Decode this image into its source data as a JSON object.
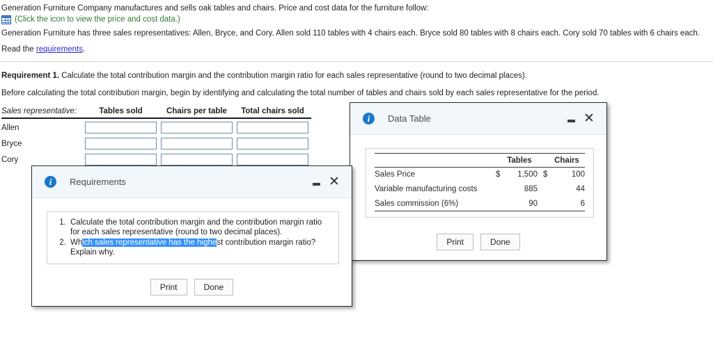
{
  "problem": {
    "intro": "Generation Furniture Company manufactures and sells oak tables and chairs. Price and cost data for the furniture follow:",
    "icon_name": "table-grid-icon",
    "icon_link": "(Click the icon to view the price and cost data.)",
    "reps_line": "Generation Furniture has three sales representatives: Allen, Bryce, and Cory. Allen sold 110 tables with 4 chairs each. Bryce sold 80 tables with 8 chairs each. Cory sold 70 tables with 6 chairs each.",
    "read_prefix": "Read the ",
    "read_link": "requirements",
    "read_suffix": "."
  },
  "requirement1": {
    "label": "Requirement 1.",
    "text": " Calculate the total contribution margin and the contribution margin ratio for each sales representative (round to two decimal places).",
    "before_text": "Before calculating the total contribution margin, begin by identifying and calculating the total number of tables and chairs sold by each sales representative for the period."
  },
  "answer_table": {
    "row_header": "Sales representative:",
    "columns": [
      "Tables sold",
      "Chairs per table",
      "Total chairs sold"
    ],
    "rows": [
      {
        "name": "Allen",
        "tables_sold": "",
        "chairs_per_table": "",
        "total_chairs_sold": ""
      },
      {
        "name": "Bryce",
        "tables_sold": "",
        "chairs_per_table": "",
        "total_chairs_sold": ""
      },
      {
        "name": "Cory",
        "tables_sold": "",
        "chairs_per_table": "",
        "total_chairs_sold": ""
      }
    ]
  },
  "requirements_dialog": {
    "title": "Requirements",
    "info_icon": "info-icon",
    "minimize_icon": "minimize-icon",
    "close_icon": "close-icon",
    "items": [
      {
        "number": "1.",
        "text": "Calculate the total contribution margin and the contribution margin ratio for each sales representative (round to two decimal places)."
      },
      {
        "number": "2.",
        "pre_selection": "Wh",
        "selection": "ich sales representative has the highe",
        "post_selection": "st contribution margin ratio? Explain why."
      }
    ],
    "print_label": "Print",
    "done_label": "Done",
    "selection_color": "#3390ff"
  },
  "data_table_dialog": {
    "title": "Data Table",
    "info_icon": "info-icon",
    "minimize_icon": "minimize-icon",
    "close_icon": "close-icon",
    "columns": [
      "Tables",
      "Chairs"
    ],
    "rows": [
      {
        "label": "Sales Price",
        "tables_currency": "$",
        "tables_value": "1,500",
        "chairs_currency": "$",
        "chairs_value": "100"
      },
      {
        "label": "Variable manufacturing costs",
        "tables_currency": "",
        "tables_value": "885",
        "chairs_currency": "",
        "chairs_value": "44"
      },
      {
        "label": "Sales commission (6%)",
        "tables_currency": "",
        "tables_value": "90",
        "chairs_currency": "",
        "chairs_value": "6"
      }
    ],
    "print_label": "Print",
    "done_label": "Done"
  },
  "theme": {
    "link_color": "#2b2bcd",
    "icon_link_color": "#2e7d32",
    "dialog_header_bg": "#f2f7fc",
    "info_icon_bg": "#1878c8",
    "input_border": "#7089ab"
  }
}
